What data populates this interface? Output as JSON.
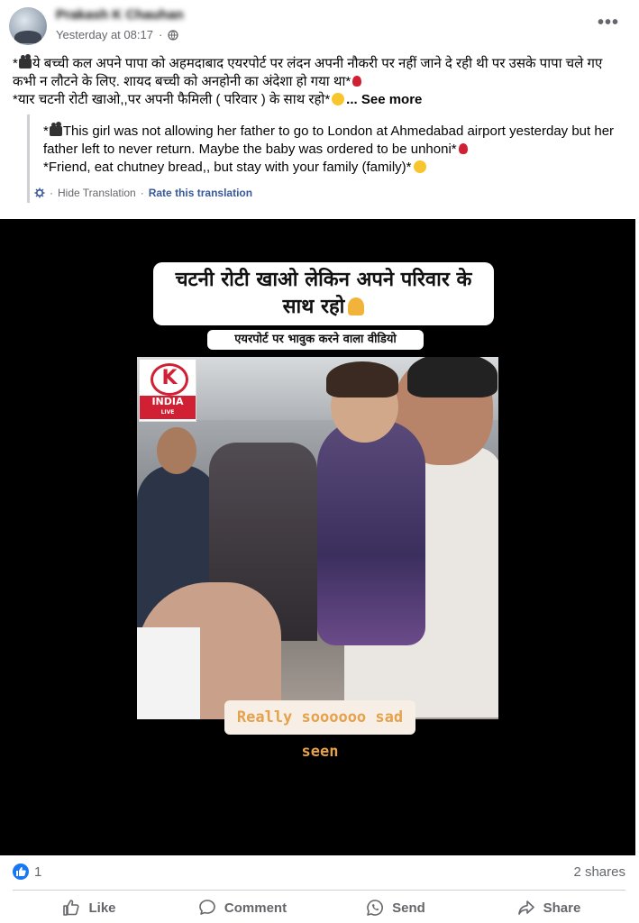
{
  "post": {
    "author": "Prakash K Chauhan",
    "timestamp": "Yesterday at 08:17",
    "separator": "·",
    "audience_icon": "globe-icon",
    "more_label": "•••",
    "text_line1": "ये बच्ची कल अपने पापा को अहमदाबाद एयरपोर्ट पर लंदन अपनी नौकरी पर नहीं जाने दे रही थी पर उसके पापा चले गए कभी न लौटने के लिए. शायद बच्ची को अनहोनी का अंदेशा हो गया था*",
    "text_line2": "*यार चटनी रोटी खाओ,,पर अपनी फैमिली ( परिवार ) के साथ रहो*",
    "see_more": "... See more"
  },
  "translation": {
    "line1": "This girl was not allowing her father to go to London at Ahmedabad airport yesterday but her father left to never return. Maybe the baby was ordered to be unhoni*",
    "line2": "*Friend, eat chutney bread,, but stay with your family (family)*",
    "hide_label": "Hide Translation",
    "dot": "·",
    "rate_label": "Rate this translation"
  },
  "media": {
    "caption_main": "चटनी रोटी खाओ लेकिन अपने परिवार के साथ रहो",
    "caption_sub": "एयरपोर्ट पर भावुक करने वाला वीडियो",
    "logo_letter": "K",
    "logo_text": "INDIA",
    "logo_sub": "LIVE",
    "caption_bottom": "Really soooooo sad seen"
  },
  "reactions": {
    "count": "1",
    "shares": "2 shares"
  },
  "actions": {
    "like": "Like",
    "comment": "Comment",
    "send": "Send",
    "share": "Share"
  },
  "colors": {
    "accent": "#1877f2",
    "link": "#385898",
    "secondary_text": "#65676b",
    "media_bg": "#000000"
  }
}
